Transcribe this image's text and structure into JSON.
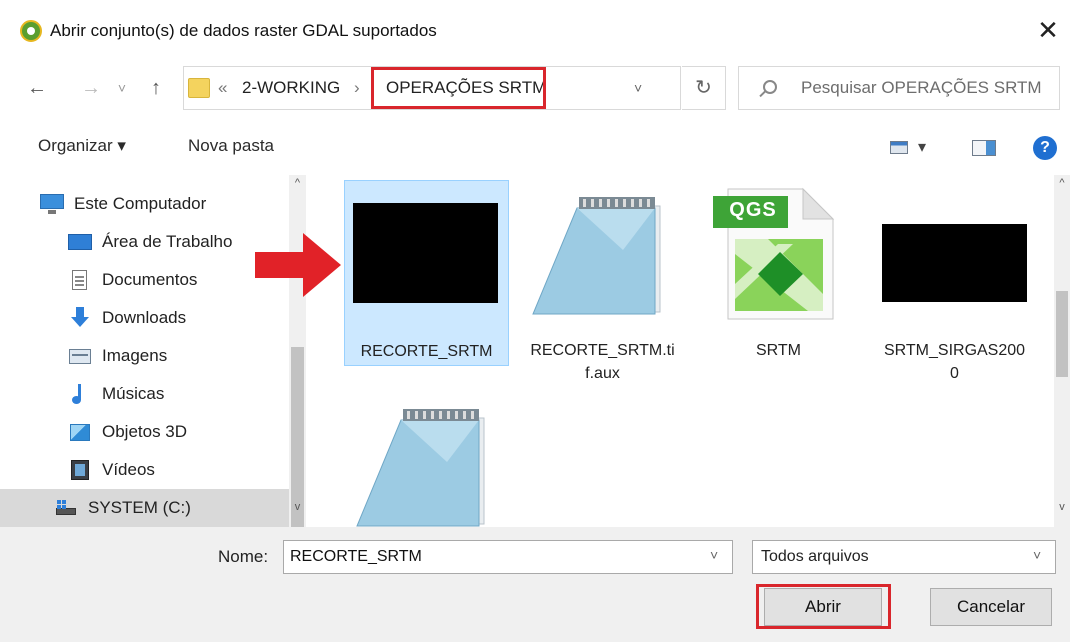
{
  "window": {
    "title": "Abrir conjunto(s) de dados raster GDAL suportados",
    "close_glyph": "✕"
  },
  "nav": {
    "back_glyph": "←",
    "forward_glyph": "→",
    "dropdown_glyph": "˅",
    "up_glyph": "↑",
    "overflow_glyph": "«",
    "separator_glyph": "›",
    "breadcrumbs": [
      "2-WORKING",
      "OPERAÇÕES SRTM"
    ],
    "refresh_glyph": "↻",
    "search_placeholder": "Pesquisar OPERAÇÕES SRTM"
  },
  "toolbar": {
    "organize_label": "Organizar ▾",
    "new_folder_label": "Nova pasta",
    "view_caret": "▾",
    "help_glyph": "?"
  },
  "sidebar": {
    "items": [
      {
        "label": "Este Computador",
        "icon": "computer-icon"
      },
      {
        "label": "Área de Trabalho",
        "icon": "desktop-icon"
      },
      {
        "label": "Documentos",
        "icon": "documents-icon"
      },
      {
        "label": "Downloads",
        "icon": "downloads-icon"
      },
      {
        "label": "Imagens",
        "icon": "pictures-icon"
      },
      {
        "label": "Músicas",
        "icon": "music-icon"
      },
      {
        "label": "Objetos 3D",
        "icon": "3d-objects-icon"
      },
      {
        "label": "Vídeos",
        "icon": "videos-icon"
      },
      {
        "label": "SYSTEM (C:)",
        "icon": "drive-icon"
      }
    ]
  },
  "files": {
    "items": [
      {
        "name_line1": "RECORTE_SRTM",
        "name_line2": "",
        "type": "raster",
        "selected": true
      },
      {
        "name_line1": "RECORTE_SRTM.ti",
        "name_line2": "f.aux",
        "type": "notepad",
        "selected": false
      },
      {
        "name_line1": "SRTM",
        "name_line2": "",
        "type": "qgs",
        "selected": false
      },
      {
        "name_line1": "SRTM_SIRGAS200",
        "name_line2": "0",
        "type": "raster",
        "selected": false
      }
    ],
    "qgs_badge": "QGS"
  },
  "footer": {
    "name_label": "Nome:",
    "name_value": "RECORTE_SRTM",
    "filter_value": "Todos arquivos",
    "open_label": "Abrir",
    "cancel_label": "Cancelar"
  },
  "colors": {
    "highlight_red": "#d9262c",
    "selection_blue": "#cce8ff",
    "qgis_green": "#4cae4c"
  }
}
